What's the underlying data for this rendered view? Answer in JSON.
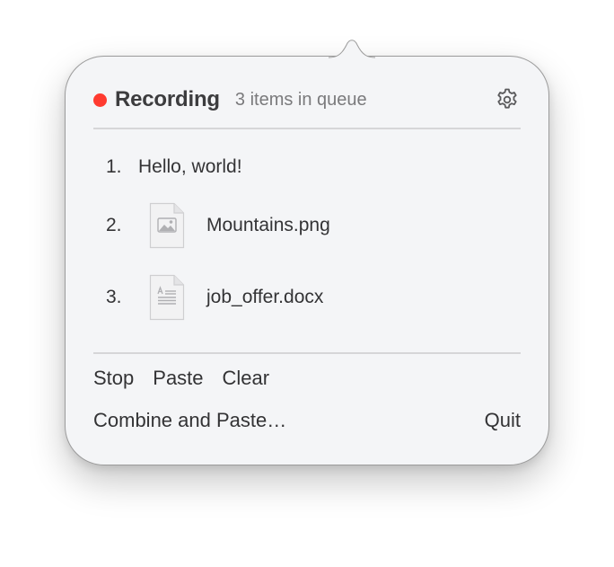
{
  "header": {
    "status": "Recording",
    "queue_text": "3 items in queue",
    "status_color": "#ff3b30"
  },
  "queue": [
    {
      "number": "1.",
      "label": "Hello, world!",
      "kind": "text"
    },
    {
      "number": "2.",
      "label": "Mountains.png",
      "kind": "image",
      "icon": "image-file-icon"
    },
    {
      "number": "3.",
      "label": "job_offer.docx",
      "kind": "document",
      "icon": "document-file-icon"
    }
  ],
  "actions": {
    "stop": "Stop",
    "paste": "Paste",
    "clear": "Clear",
    "combine": "Combine and Paste…",
    "quit": "Quit"
  },
  "icons": {
    "settings": "gear-icon"
  }
}
